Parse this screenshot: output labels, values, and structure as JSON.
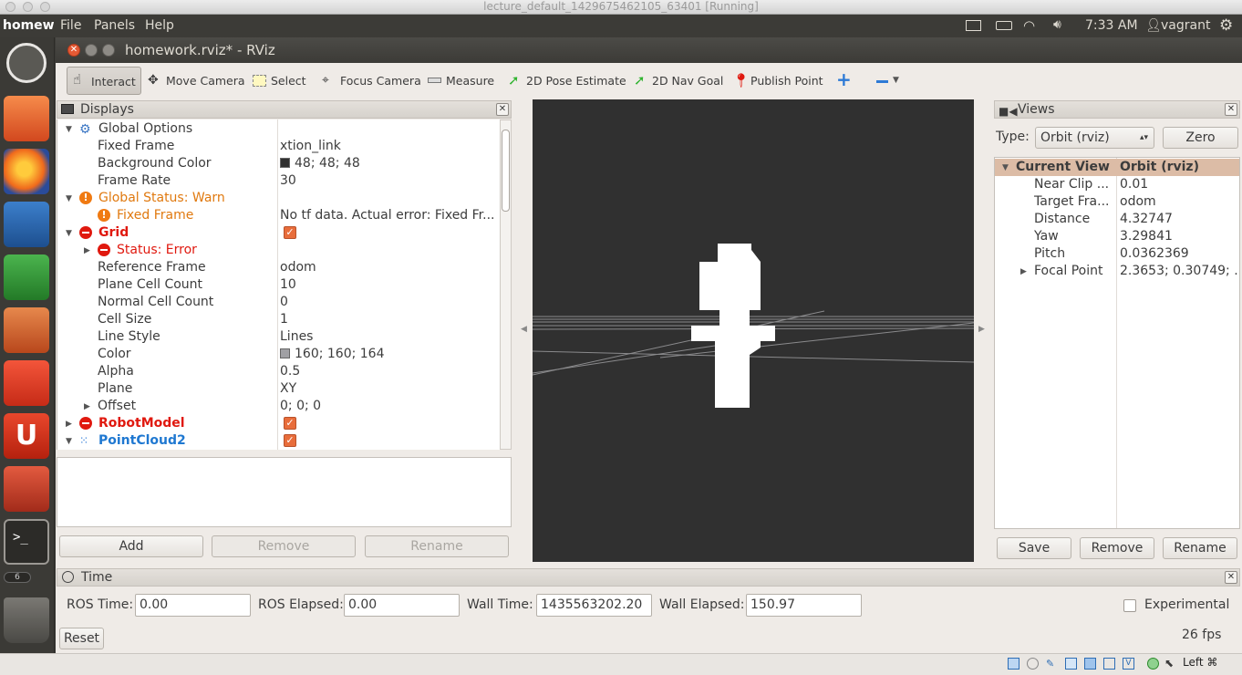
{
  "vm_title": "lecture_default_1429675462105_63401 [Running]",
  "topbar": {
    "app_name": "homew",
    "menus": [
      "File",
      "Panels",
      "Help"
    ],
    "clock": "7:33 AM",
    "user": "vagrant"
  },
  "window": {
    "title": "homework.rviz* - RViz"
  },
  "toolbar": {
    "interact": "Interact",
    "move_camera": "Move Camera",
    "select": "Select",
    "focus_camera": "Focus Camera",
    "measure": "Measure",
    "pose_estimate": "2D Pose Estimate",
    "nav_goal": "2D Nav Goal",
    "publish_point": "Publish Point"
  },
  "displays": {
    "title": "Displays",
    "global_options": "Global Options",
    "fixed_frame_k": "Fixed Frame",
    "fixed_frame_v": "xtion_link",
    "bg_color_k": "Background Color",
    "bg_color_v": "48; 48; 48",
    "frame_rate_k": "Frame Rate",
    "frame_rate_v": "30",
    "global_status": "Global Status: Warn",
    "status_ff_k": "Fixed Frame",
    "status_ff_v": "No tf data.  Actual error: Fixed Fr...",
    "grid": "Grid",
    "grid_status": "Status: Error",
    "ref_frame_k": "Reference Frame",
    "ref_frame_v": "odom",
    "plane_cells_k": "Plane Cell Count",
    "plane_cells_v": "10",
    "normal_cells_k": "Normal Cell Count",
    "normal_cells_v": "0",
    "cell_size_k": "Cell Size",
    "cell_size_v": "1",
    "line_style_k": "Line Style",
    "line_style_v": "Lines",
    "color_k": "Color",
    "color_v": "160; 160; 164",
    "alpha_k": "Alpha",
    "alpha_v": "0.5",
    "plane_k": "Plane",
    "plane_v": "XY",
    "offset_k": "Offset",
    "offset_v": "0; 0; 0",
    "robot_model": "RobotModel",
    "pointcloud2": "PointCloud2",
    "add": "Add",
    "remove": "Remove",
    "rename": "Rename"
  },
  "views": {
    "title": "Views",
    "type_label": "Type:",
    "type_value": "Orbit (rviz)",
    "zero": "Zero",
    "cur_k": "Current View",
    "cur_v": "Orbit (rviz)",
    "near_k": "Near Clip ...",
    "near_v": "0.01",
    "target_k": "Target Fra...",
    "target_v": "odom",
    "dist_k": "Distance",
    "dist_v": "4.32747",
    "yaw_k": "Yaw",
    "yaw_v": "3.29841",
    "pitch_k": "Pitch",
    "pitch_v": "0.0362369",
    "focal_k": "Focal Point",
    "focal_v": "2.3653; 0.30749; ...",
    "save": "Save",
    "remove": "Remove",
    "rename": "Rename"
  },
  "time": {
    "title": "Time",
    "ros_time_l": "ROS Time:",
    "ros_time_v": "0.00",
    "ros_elapsed_l": "ROS Elapsed:",
    "ros_elapsed_v": "0.00",
    "wall_time_l": "Wall Time:",
    "wall_time_v": "1435563202.20",
    "wall_elapsed_l": "Wall Elapsed:",
    "wall_elapsed_v": "150.97",
    "experimental": "Experimental",
    "reset": "Reset",
    "fps": "26 fps"
  },
  "launcher_badge": "6",
  "host_key": "Left ⌘",
  "colors": {
    "render_bg": "#303030",
    "ubuntu_orange": "#e95420",
    "error": "#e0190f",
    "warn": "#f07a12"
  }
}
